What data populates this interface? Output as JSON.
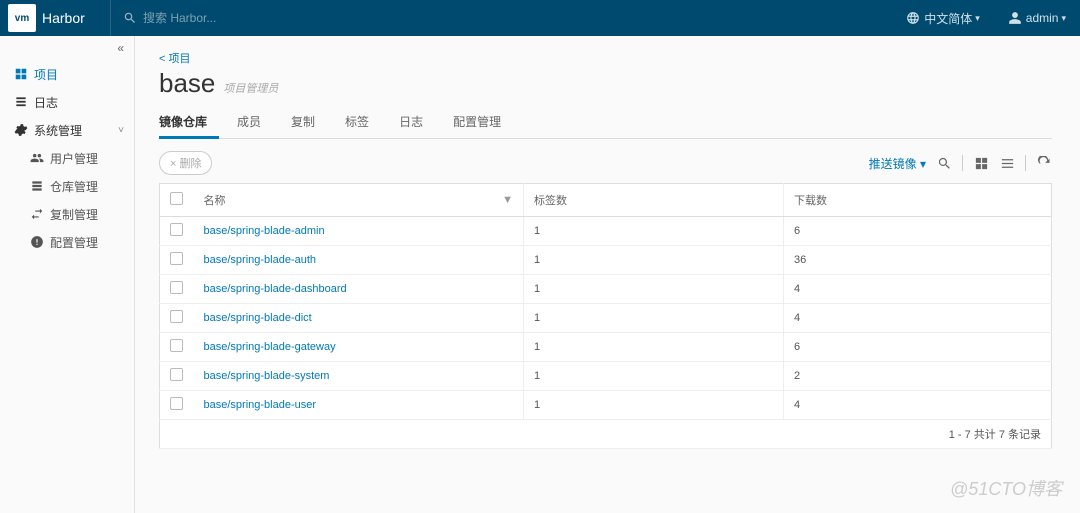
{
  "top": {
    "product": "Harbor",
    "logo_text": "vm",
    "search_placeholder": "搜索 Harbor...",
    "lang": "中文简体",
    "user": "admin"
  },
  "sidebar": {
    "items": [
      {
        "label": "项目",
        "active": true
      },
      {
        "label": "日志",
        "active": false
      },
      {
        "label": "系统管理",
        "expandable": true
      }
    ],
    "subitems": [
      {
        "label": "用户管理"
      },
      {
        "label": "仓库管理"
      },
      {
        "label": "复制管理"
      },
      {
        "label": "配置管理"
      }
    ]
  },
  "main": {
    "back_text": "< 项目",
    "project_name": "base",
    "project_role": "项目管理员",
    "tabs": [
      {
        "label": "镜像仓库",
        "active": true
      },
      {
        "label": "成员"
      },
      {
        "label": "复制"
      },
      {
        "label": "标签"
      },
      {
        "label": "日志"
      },
      {
        "label": "配置管理"
      }
    ],
    "delete_btn": "× 删除",
    "push_link": "推送镜像 ▾",
    "columns": {
      "name": "名称",
      "tags": "标签数",
      "downloads": "下载数"
    },
    "rows": [
      {
        "name": "base/spring-blade-admin",
        "tags": "1",
        "downloads": "6"
      },
      {
        "name": "base/spring-blade-auth",
        "tags": "1",
        "downloads": "36"
      },
      {
        "name": "base/spring-blade-dashboard",
        "tags": "1",
        "downloads": "4"
      },
      {
        "name": "base/spring-blade-dict",
        "tags": "1",
        "downloads": "4"
      },
      {
        "name": "base/spring-blade-gateway",
        "tags": "1",
        "downloads": "6"
      },
      {
        "name": "base/spring-blade-system",
        "tags": "1",
        "downloads": "2"
      },
      {
        "name": "base/spring-blade-user",
        "tags": "1",
        "downloads": "4"
      }
    ],
    "pagination": "1 - 7 共计 7 条记录"
  },
  "watermark": "@51CTO博客"
}
